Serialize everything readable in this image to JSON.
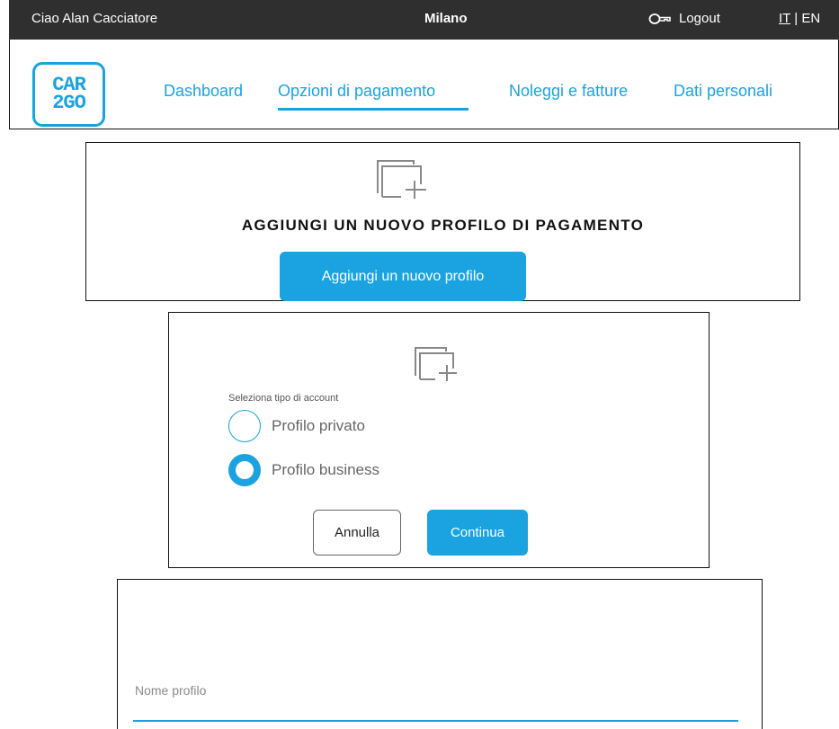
{
  "topbar": {
    "greeting": "Ciao  Alan Cacciatore",
    "city": "Milano",
    "logout_label": "Logout",
    "lang_active": "IT",
    "lang_sep": "|",
    "lang_other": "EN",
    "key_icon": "key-icon"
  },
  "header": {
    "logo_line1": "CAR",
    "logo_line2": "2GO",
    "nav": {
      "dashboard": "Dashboard",
      "pagamento": "Opzioni di pagamento",
      "noleggi": "Noleggi e fatture",
      "dati": "Dati personali"
    },
    "active_nav": "Opzioni di pagamento"
  },
  "add_profile": {
    "icon": "add-cards-icon",
    "title": "AGGIUNGI UN NUOVO PROFILO DI PAGAMENTO",
    "button_label": "Aggiungi un nuovo profilo"
  },
  "account_type": {
    "icon": "add-cards-icon",
    "label": "Seleziona tipo di account",
    "options": [
      {
        "label": "Profilo privato",
        "selected": false
      },
      {
        "label": "Profilo business",
        "selected": true
      }
    ],
    "cancel_label": "Annulla",
    "continue_label": "Continua"
  },
  "profile_form": {
    "name_label": "Nome profilo",
    "name_value": ""
  },
  "colors": {
    "accent": "#1aa3e0",
    "topbar_bg": "#2f2f2f"
  }
}
